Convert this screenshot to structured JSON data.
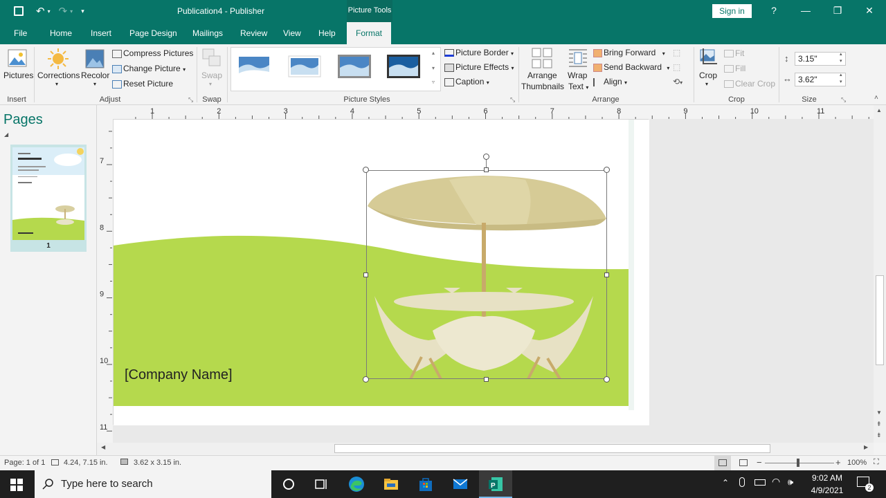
{
  "titlebar": {
    "title": "Publication4  -  Publisher",
    "context_tab": "Picture Tools",
    "sign_in": "Sign in",
    "help": "?",
    "minimize": "—",
    "restore": "❐",
    "close": "✕"
  },
  "tabs": [
    "File",
    "Home",
    "Insert",
    "Page Design",
    "Mailings",
    "Review",
    "View",
    "Help",
    "Format"
  ],
  "ribbon": {
    "insert_group": {
      "pictures": "Pictures",
      "label": "Insert"
    },
    "adjust_group": {
      "corrections": "Corrections",
      "recolor": "Recolor",
      "compress": "Compress Pictures",
      "change": "Change Picture",
      "reset": "Reset Picture",
      "label": "Adjust"
    },
    "swap_group": {
      "swap": "Swap",
      "label": "Swap"
    },
    "styles_group": {
      "label": "Picture Styles"
    },
    "border_group": {
      "border": "Picture Border",
      "effects": "Picture Effects",
      "caption": "Caption"
    },
    "arrange_group": {
      "arrange_thumbs_1": "Arrange",
      "arrange_thumbs_2": "Thumbnails",
      "wrap_1": "Wrap",
      "wrap_2": "Text",
      "bring_forward": "Bring Forward",
      "send_backward": "Send Backward",
      "align": "Align",
      "label": "Arrange"
    },
    "crop_group": {
      "crop": "Crop",
      "fit": "Fit",
      "fill": "Fill",
      "clear_crop": "Clear Crop",
      "label": "Crop"
    },
    "size_group": {
      "height": "3.15\"",
      "width": "3.62\"",
      "label": "Size"
    }
  },
  "pages_pane": {
    "header": "Pages",
    "page_number": "1"
  },
  "document": {
    "company_name": "[Company Name]"
  },
  "ruler": {
    "h_labels": [
      "1",
      "2",
      "3",
      "4",
      "5",
      "6",
      "7",
      "8",
      "9",
      "10",
      "11"
    ],
    "v_labels": [
      "7",
      "8",
      "9",
      "10",
      "11"
    ]
  },
  "status": {
    "page": "Page: 1 of 1",
    "position": "4.24, 7.15 in.",
    "size": "3.62 x 3.15 in.",
    "zoom": "100%"
  },
  "taskbar": {
    "search_placeholder": "Type here to search",
    "time": "9:02 AM",
    "date": "4/9/2021"
  },
  "colors": {
    "accent": "#077568",
    "grass": "#b5d94d",
    "umbrella": "#d8cfa0"
  }
}
